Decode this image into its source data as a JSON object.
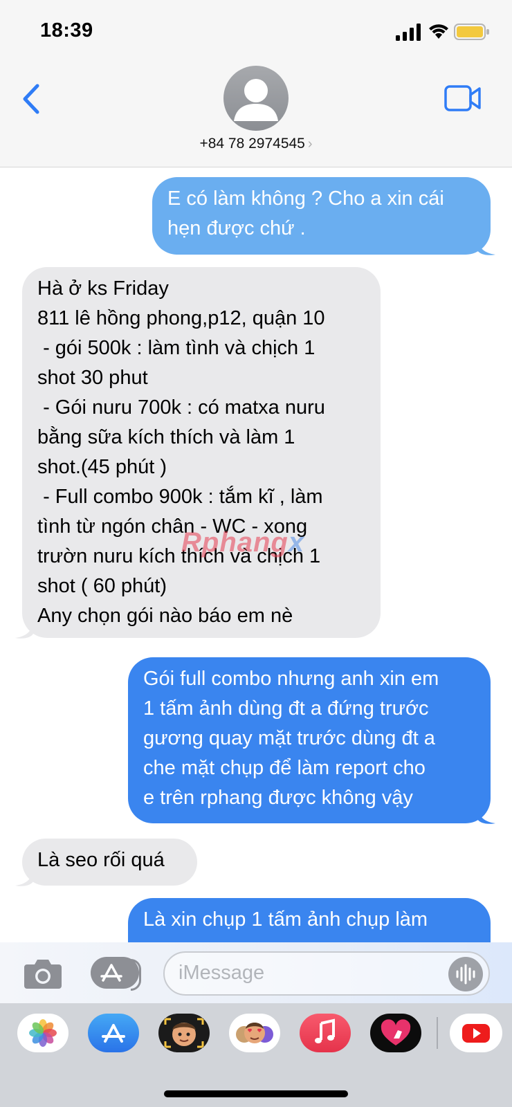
{
  "status_bar": {
    "time": "18:39"
  },
  "header": {
    "contact": "+84 78 2974545",
    "chevron": "›"
  },
  "messages": [
    {
      "direction": "outgoing",
      "text": "E có làm không ? Cho a xin cái\nhẹn được chứ ."
    },
    {
      "direction": "incoming",
      "text": "Hà ở ks Friday\n811 lê hồng phong,p12, quận 10\n - gói 500k : làm tình và chịch 1\nshot 30 phut\n - Gói nuru 700k : có matxa nuru\nbằng sữa kích thích và làm 1\nshot.(45 phút )\n - Full combo 900k : tắm kĩ , làm\ntình từ ngón chân - WC - xong\ntrườn nuru kích thích và chịch 1\nshot ( 60 phút)\nAny chọn gói nào báo em nè"
    },
    {
      "direction": "outgoing",
      "text": "Gói full combo nhưng anh xin em\n1 tấm ảnh dùng đt a đứng trước\ngương quay mặt trước dùng đt a\nche mặt chụp để làm report cho\ne trên rphang được không vậy"
    },
    {
      "direction": "incoming",
      "text": "Là seo rối quá"
    },
    {
      "direction": "outgoing",
      "text": "Là xin chụp 1 tấm ảnh chụp làm"
    }
  ],
  "watermark": {
    "part1": "Rphang",
    "part2": "x"
  },
  "composer": {
    "placeholder": "iMessage"
  },
  "dock": {
    "apps": [
      "photos-icon",
      "app-store-icon",
      "memoji-icon",
      "animoji-icon",
      "music-icon",
      "digital-touch-icon",
      "youtube-icon"
    ]
  },
  "colors": {
    "incoming_bubble": "#e9e9eb",
    "outgoing_bubble_light": "#6aaef0",
    "outgoing_bubble": "#3a85ef",
    "accent": "#2f7cf6"
  }
}
